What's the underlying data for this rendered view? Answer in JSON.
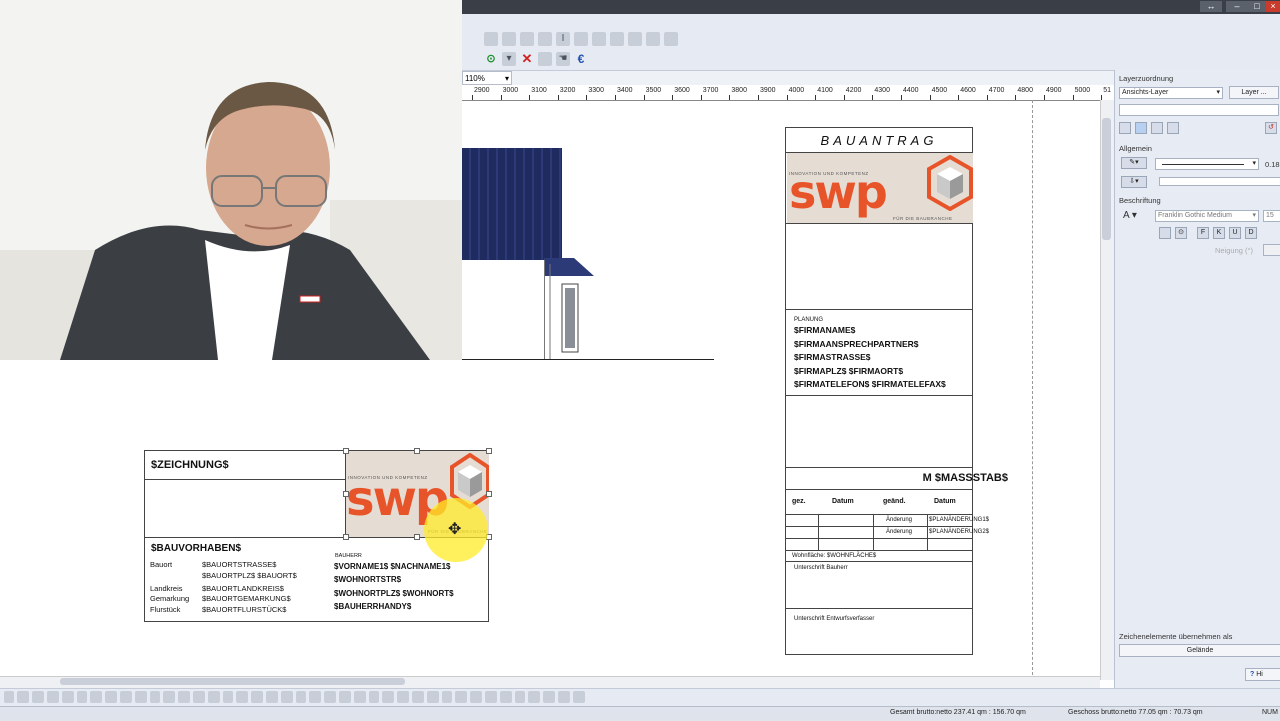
{
  "toolbar": {
    "zoom": "110%",
    "euro_symbol": "€",
    "icons_row1": [
      "toolbar-icon",
      "toolbar-icon",
      "toolbar-icon",
      "toolbar-icon",
      "toolbar-icon",
      "toolbar-icon",
      "toolbar-icon",
      "toolbar-icon",
      "toolbar-icon",
      "toolbar-icon",
      "toolbar-icon"
    ]
  },
  "ruler": {
    "ticks": [
      "2900",
      "3000",
      "3100",
      "3200",
      "3300",
      "3400",
      "3500",
      "3600",
      "3700",
      "3800",
      "3900",
      "4000",
      "4100",
      "4200",
      "4300",
      "4400",
      "4500",
      "4600",
      "4700",
      "4800",
      "4900",
      "5000",
      "51"
    ]
  },
  "panel": {
    "layer_header": "Layerzuordnung",
    "layer_select": "Ansichts-Layer",
    "layer_button": "Layer ...",
    "allgemein": "Allgemein",
    "line_value": "0.18",
    "beschriftung": "Beschriftung",
    "font_select": "Franklin Gothic Medium",
    "font_size": "15",
    "style_buttons": [
      "F",
      "K",
      "U",
      "D"
    ],
    "faded_label": "Neigung (°)",
    "zeichenelemente": "Zeichenelemente übernehmen als",
    "gelaende_button": "Gelände",
    "help_button": "Hi"
  },
  "statusbar": {
    "gesamt": "Gesamt brutto:netto 237.41 qm : 156.70 qm",
    "geschoss": "Geschoss brutto:netto 77.05 qm : 70.73 qm",
    "num": "NUM"
  },
  "title_block": {
    "title": "BAUANTRAG",
    "logo_text": "swp",
    "logo_tagline_top": "INNOVATION UND KOMPETENZ",
    "logo_tagline_bottom": "FÜR DIE BAUBRANCHE",
    "planung_label": "PLANUNG",
    "firma_lines": [
      "$FIRMANAME$",
      "$FIRMAANSPRECHPARTNER$",
      "$FIRMASTRASSE$",
      "$FIRMAPLZ$ $FIRMAORT$",
      "$FIRMATELEFON$ $FIRMATELEFAX$"
    ],
    "massstab": "M $MASSSTAB$",
    "table_headers": [
      "gez.",
      "Datum",
      "geänd.",
      "Datum"
    ],
    "aenderung_rows": [
      {
        "label": "Änderung",
        "value": "$PLANÄNDERUNG1$"
      },
      {
        "label": "Änderung",
        "value": "$PLANÄNDERUNG2$"
      }
    ],
    "wohnflaeche": "Wohnfläche: $WOHNFLÄCHE$",
    "unterschrift_bauherr": "Unterschrift Bauherr",
    "unterschrift_entwurf": "Unterschrift Entwurfsverfasser"
  },
  "plan_block": {
    "zeichnung": "$ZEICHNUNG$",
    "bauvorhaben": "$BAUVORHABEN$",
    "bauort_label": "Bauort",
    "bauort_lines": [
      "$BAUORTSTRASSE$",
      "$BAUORTPLZ$ $BAUORT$"
    ],
    "landkreis_label": "Landkreis",
    "landkreis": "$BAUORTLANDKREIS$",
    "gemarkung_label": "Gemarkung",
    "gemarkung": "$BAUORTGEMARKUNG$",
    "flurstueck_label": "Flurstück",
    "flurstueck": "$BAUORTFLURSTÜCK$",
    "bauherr_label": "BAUHERR",
    "bauherr_lines": [
      "$VORNAME1$ $NACHNAME1$",
      "$WOHNORTSTR$",
      "$WOHNORTPLZ$ $WOHNORT$",
      "$BAUHERRHANDY$"
    ],
    "logo_text": "swp",
    "logo_tagline_top": "INNOVATION UND KOMPETENZ",
    "logo_tagline_bottom": "FÜR DIE BAUBRANCHE",
    "move_cursor": "✥"
  },
  "colors": {
    "accent_orange": "#e8542a",
    "roof_blue": "#1f2a5e",
    "highlight_yellow": "#ffeb28"
  }
}
